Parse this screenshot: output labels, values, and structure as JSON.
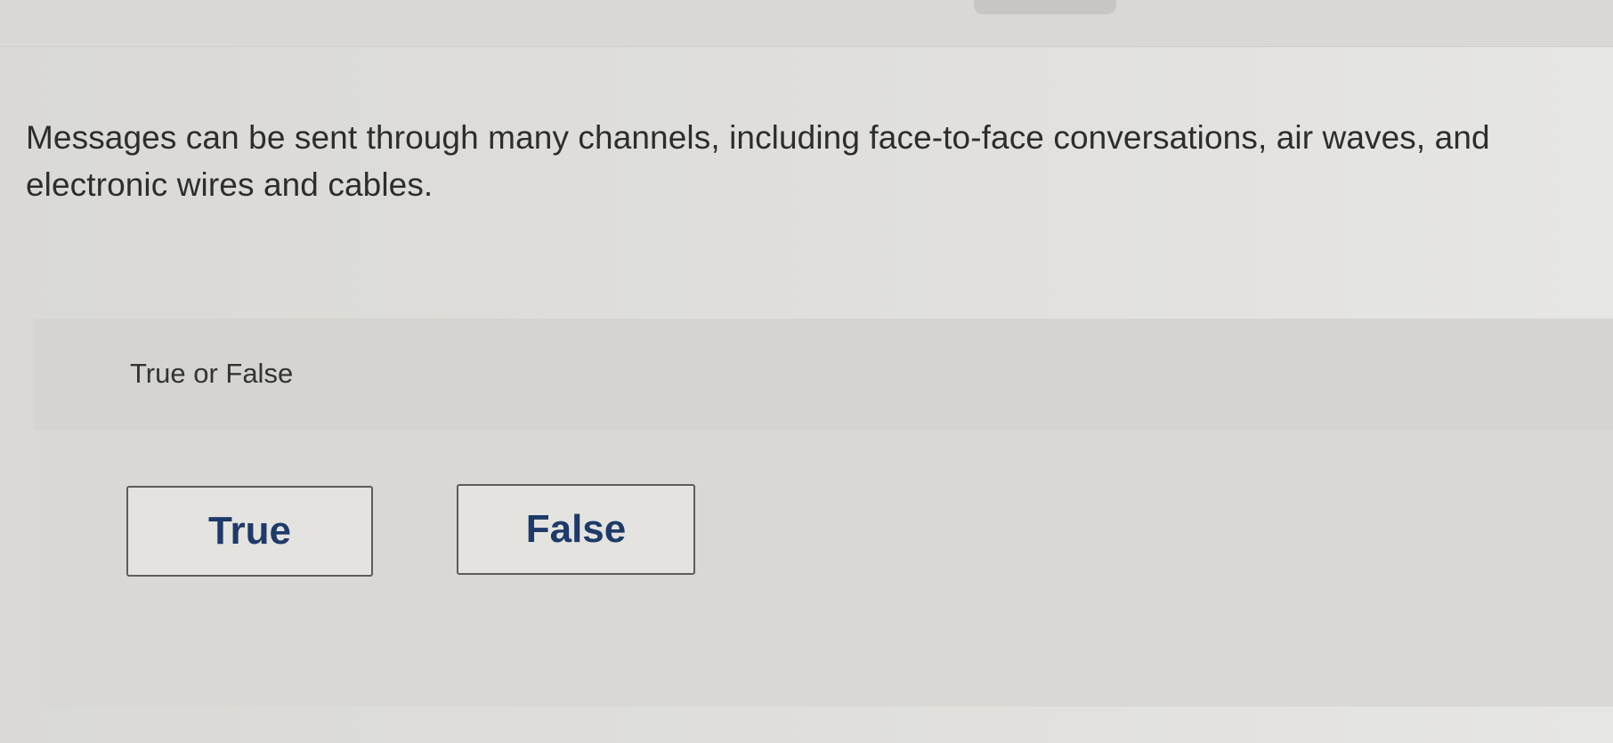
{
  "question": {
    "text": "Messages can be sent through many channels, including face-to-face conversations, air waves, and electronic wires and cables."
  },
  "answer_panel": {
    "prompt": "True or False",
    "options": [
      {
        "label": "True"
      },
      {
        "label": "False"
      }
    ]
  },
  "colors": {
    "background": "#dcdbd7",
    "panel": "#d5d4d0",
    "button_text": "#1e3a6a",
    "button_border": "#5c5c5c"
  }
}
